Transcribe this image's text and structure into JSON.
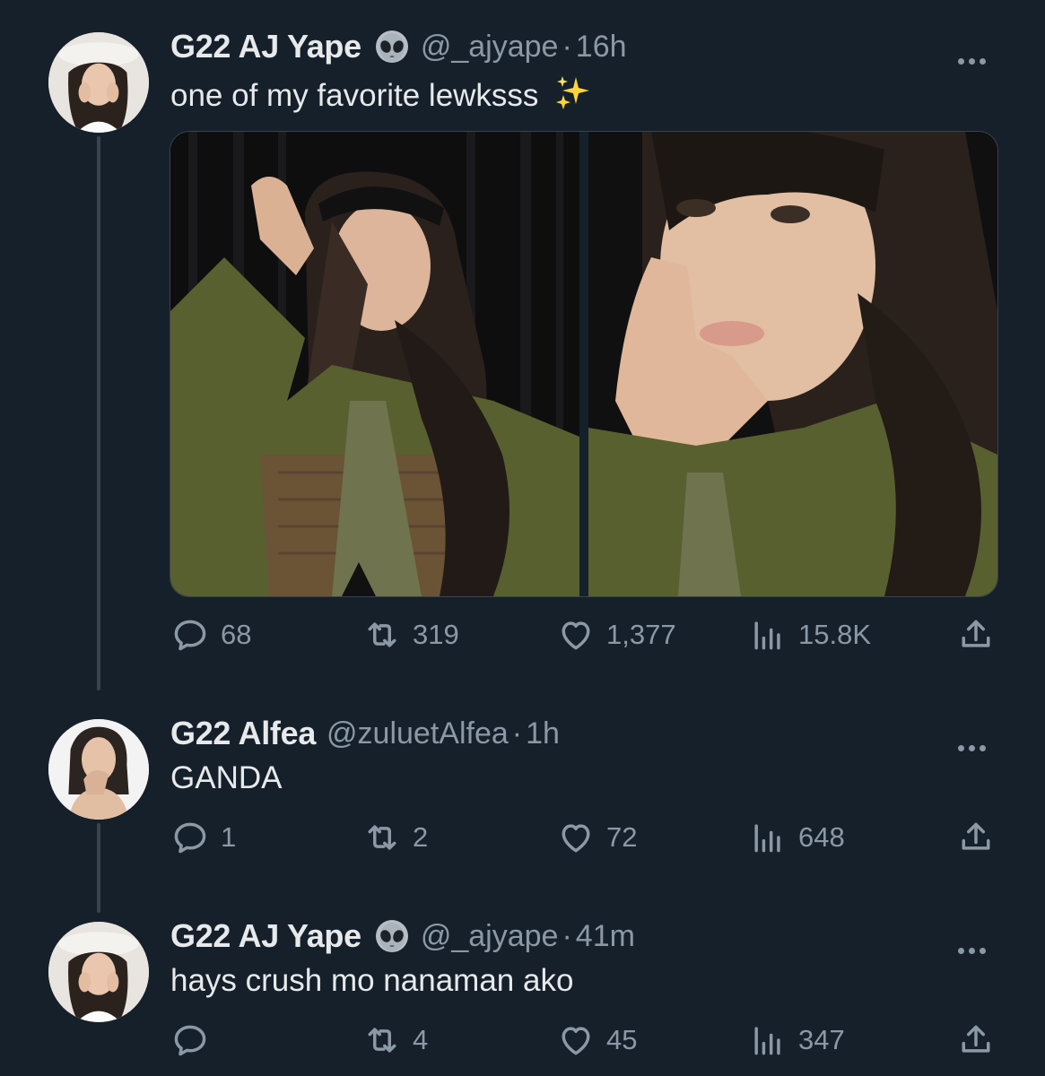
{
  "colors": {
    "background": "#15202b",
    "primary_text": "#e7e9ea",
    "secondary_text": "#8b98a5",
    "thread_line": "#38444d"
  },
  "icons": [
    "alien-badge-icon",
    "sparkles-icon",
    "reply-icon",
    "retweet-icon",
    "like-icon",
    "views-icon",
    "share-icon",
    "more-icon"
  ],
  "tweets": [
    {
      "name": "G22 AJ Yape",
      "badge": "👽",
      "handle": "@_ajyape",
      "separator": "·",
      "time": "16h",
      "text": "one of my favorite lewksss",
      "text_emoji": "✨",
      "stats": {
        "replies": "68",
        "retweets": "319",
        "likes": "1,377",
        "views": "15.8K"
      }
    },
    {
      "name": "G22 Alfea",
      "handle": "@zuluetAlfea",
      "separator": "·",
      "time": "1h",
      "text": "GANDA",
      "stats": {
        "replies": "1",
        "retweets": "2",
        "likes": "72",
        "views": "648"
      }
    },
    {
      "name": "G22 AJ Yape",
      "badge": "👽",
      "handle": "@_ajyape",
      "separator": "·",
      "time": "41m",
      "text": "hays crush mo nanaman ako",
      "stats": {
        "replies": "",
        "retweets": "4",
        "likes": "45",
        "views": "347"
      }
    }
  ]
}
